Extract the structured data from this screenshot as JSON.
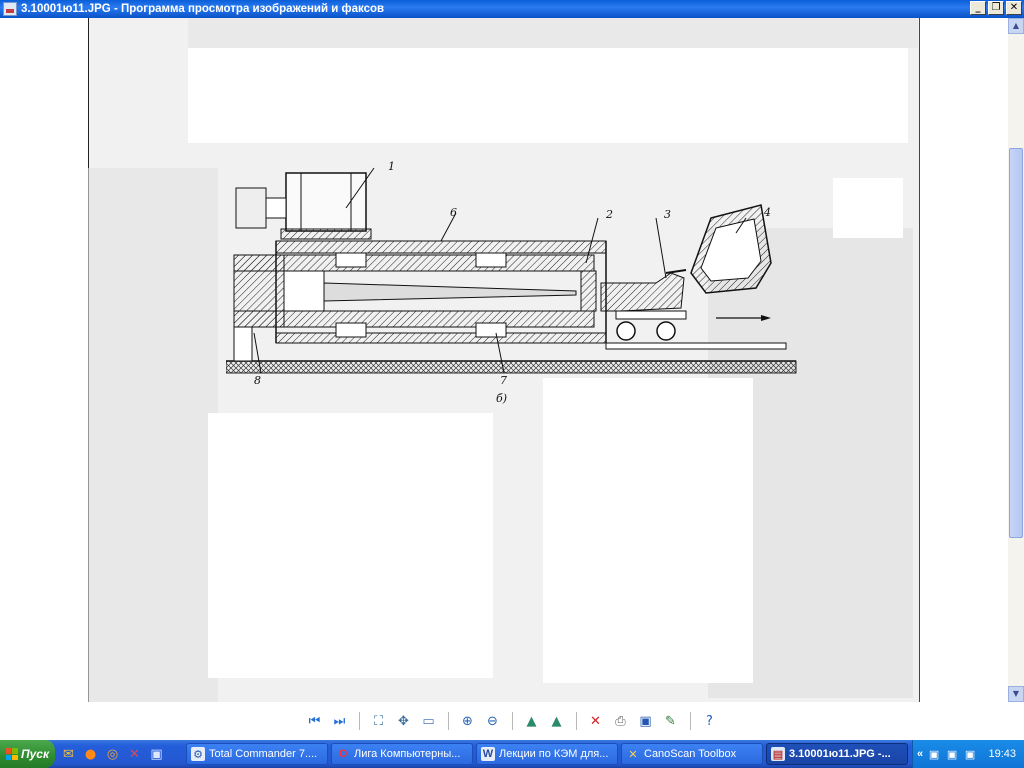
{
  "window": {
    "title": "3.10001ю11.JPG - Программа просмотра изображений и факсов",
    "icon": "image-viewer-icon",
    "buttons": [
      "minimize",
      "restore",
      "close"
    ]
  },
  "image": {
    "callouts": [
      "1",
      "6",
      "2",
      "3",
      "4",
      "8",
      "7",
      "б)"
    ]
  },
  "toolbar": {
    "groups": [
      [
        "previous-image-icon",
        "next-image-icon"
      ],
      [
        "best-fit-icon",
        "actual-size-icon",
        "slideshow-icon"
      ],
      [
        "zoom-in-icon",
        "zoom-out-icon"
      ],
      [
        "rotate-clockwise-icon",
        "rotate-counterclockwise-icon"
      ],
      [
        "delete-icon",
        "print-icon",
        "save-icon",
        "edit-icon"
      ],
      [
        "help-icon"
      ]
    ]
  },
  "taskbar": {
    "start_label": "Пуск",
    "quick_launch": [
      "outlook-icon",
      "firefox-icon",
      "opera-icon",
      "app-icon",
      "save-disk-icon"
    ],
    "tasks": [
      {
        "label": "Total Commander 7....",
        "icon": "total-commander-icon",
        "active": false
      },
      {
        "label": "Лига Компьютерны...",
        "icon": "opera-icon",
        "active": false
      },
      {
        "label": "Лекции по КЭМ для...",
        "icon": "word-icon",
        "active": false
      },
      {
        "label": "CanoScan Toolbox",
        "icon": "canoscan-icon",
        "active": false
      },
      {
        "label": "3.10001ю11.JPG -...",
        "icon": "image-viewer-icon",
        "active": true
      }
    ],
    "tray": {
      "expand": "«",
      "icons": [
        "network-icon",
        "network-icon",
        "network-icon"
      ],
      "clock": "19:43"
    }
  }
}
